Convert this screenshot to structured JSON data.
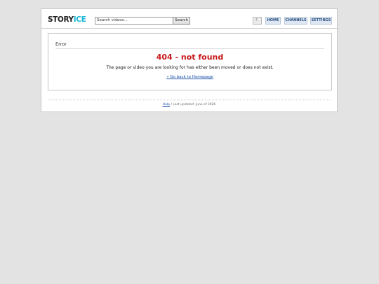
{
  "header": {
    "logo_part1": "STORY",
    "logo_part2": "ICE",
    "search_placeholder": "Search videos...",
    "search_button": "Search",
    "theme_icon": "moon-icon",
    "nav": [
      "HOME",
      "CHANNELS",
      "SETTINGS"
    ]
  },
  "panel": {
    "title": "Error",
    "heading": "404 - not found",
    "message": "The page or video you are looking for has either been moved or does not exist.",
    "home_link": "« Go back to Homepage"
  },
  "footer": {
    "help_link": "Help",
    "separator": "/",
    "last_updated": "Last updated: June of 2026"
  },
  "colors": {
    "accent": "#18b6d6",
    "error": "#c8191b",
    "link": "#1a4fa8"
  }
}
